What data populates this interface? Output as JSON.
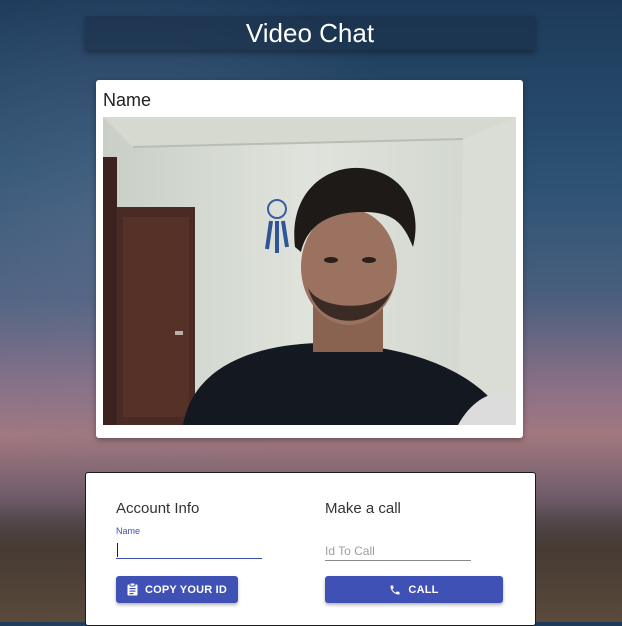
{
  "header": {
    "title": "Video Chat"
  },
  "video": {
    "name_label": "Name"
  },
  "account": {
    "title": "Account Info",
    "name_label": "Name",
    "name_value": "",
    "copy_button": "COPY YOUR ID"
  },
  "call": {
    "title": "Make a call",
    "id_placeholder": "Id To Call",
    "call_button": "CALL"
  },
  "colors": {
    "accent": "#3f51b5",
    "header_bg": "#1f3a57"
  },
  "icons": {
    "copy": "clipboard-icon",
    "call": "phone-icon"
  }
}
